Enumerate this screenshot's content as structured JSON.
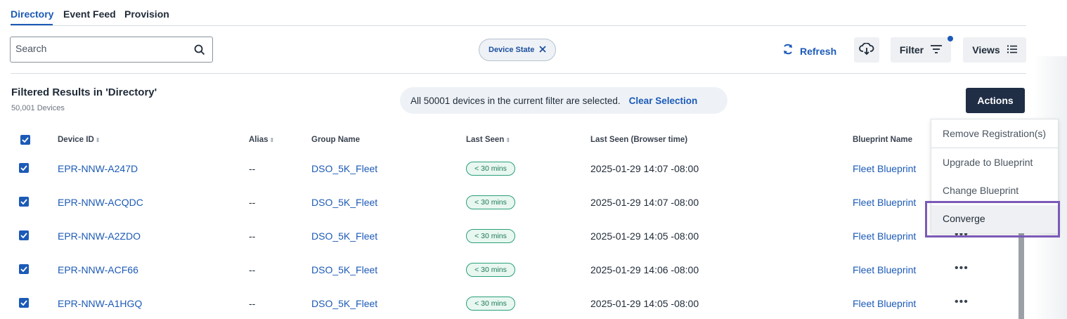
{
  "tabs": [
    {
      "label": "Directory",
      "active": true
    },
    {
      "label": "Event Feed",
      "active": false
    },
    {
      "label": "Provision",
      "active": false
    }
  ],
  "search": {
    "placeholder": "Search",
    "value": ""
  },
  "filter_chip": {
    "label": "Device State"
  },
  "toolbar": {
    "refresh_label": "Refresh",
    "filter_label": "Filter",
    "views_label": "Views"
  },
  "results": {
    "title": "Filtered Results in 'Directory'",
    "count": "50,001 Devices"
  },
  "selection_banner": {
    "message": "All 50001 devices in the current filter are selected.",
    "clear_label": "Clear Selection"
  },
  "actions_label": "Actions",
  "table": {
    "columns": [
      "Device ID",
      "Alias",
      "Group Name",
      "Last Seen",
      "Last Seen (Browser time)",
      "Blueprint Name"
    ],
    "rows": [
      {
        "device_id": "EPR-NNW-A247D",
        "alias": "--",
        "group": "DSO_5K_Fleet",
        "last_seen": "< 30 mins",
        "browser_time": "2025-01-29 14:07 -08:00",
        "blueprint": "Fleet Blueprint",
        "checked": true
      },
      {
        "device_id": "EPR-NNW-ACQDC",
        "alias": "--",
        "group": "DSO_5K_Fleet",
        "last_seen": "< 30 mins",
        "browser_time": "2025-01-29 14:07 -08:00",
        "blueprint": "Fleet Blueprint",
        "checked": true
      },
      {
        "device_id": "EPR-NNW-A2ZDO",
        "alias": "--",
        "group": "DSO_5K_Fleet",
        "last_seen": "< 30 mins",
        "browser_time": "2025-01-29 14:05 -08:00",
        "blueprint": "Fleet Blueprint",
        "checked": true
      },
      {
        "device_id": "EPR-NNW-ACF66",
        "alias": "--",
        "group": "DSO_5K_Fleet",
        "last_seen": "< 30 mins",
        "browser_time": "2025-01-29 14:06 -08:00",
        "blueprint": "Fleet Blueprint",
        "checked": true
      },
      {
        "device_id": "EPR-NNW-A1HGQ",
        "alias": "--",
        "group": "DSO_5K_Fleet",
        "last_seen": "< 30 mins",
        "browser_time": "2025-01-29 14:05 -08:00",
        "blueprint": "Fleet Blueprint",
        "checked": true
      }
    ]
  },
  "actions_menu": {
    "items": [
      "Remove Registration(s)",
      "Upgrade to Blueprint",
      "Change Blueprint",
      "Converge"
    ],
    "highlighted": "Converge"
  },
  "row_menu_glyph": "•••",
  "colors": {
    "accent": "#1c5ab7",
    "actions_bg": "#1f2d45",
    "badge_green": "#2aa07a",
    "focus_outline": "#7b5ab8"
  }
}
